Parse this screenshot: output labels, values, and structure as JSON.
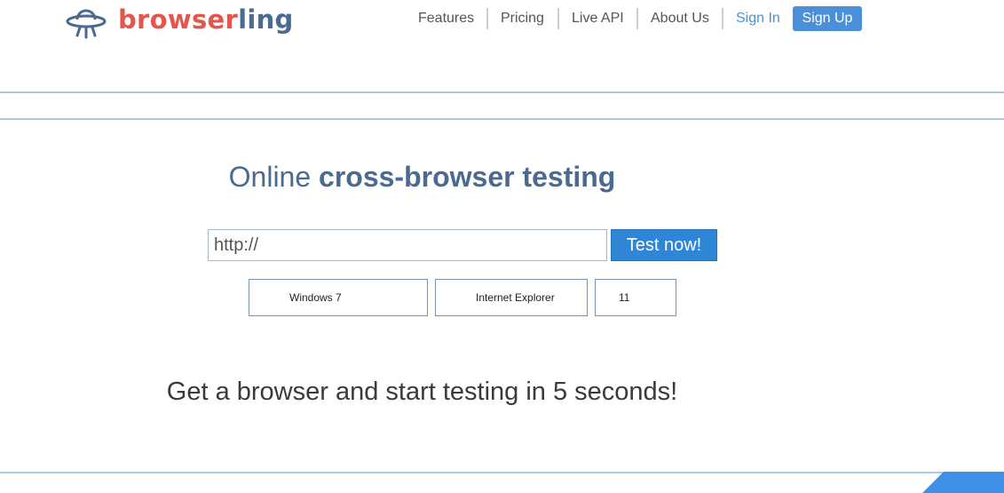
{
  "brand": {
    "name_part1": "browser",
    "name_part2": "ling",
    "color_primary": "#e2574c",
    "color_secondary": "#4a6a91",
    "logo_icon": "ufo-icon"
  },
  "nav": {
    "features": "Features",
    "pricing": "Pricing",
    "live_api": "Live API",
    "about_us": "About Us",
    "sign_in": "Sign In",
    "sign_up": "Sign Up",
    "accent_color": "#4a90d9"
  },
  "hero": {
    "title_plain": "Online ",
    "title_bold": "cross-browser testing",
    "url_value": "http://",
    "test_button": "Test now!",
    "os_select": "Windows 7",
    "browser_select": "Internet Explorer",
    "version_select": "11",
    "tagline": "Get a browser and start testing in 5 seconds!"
  }
}
